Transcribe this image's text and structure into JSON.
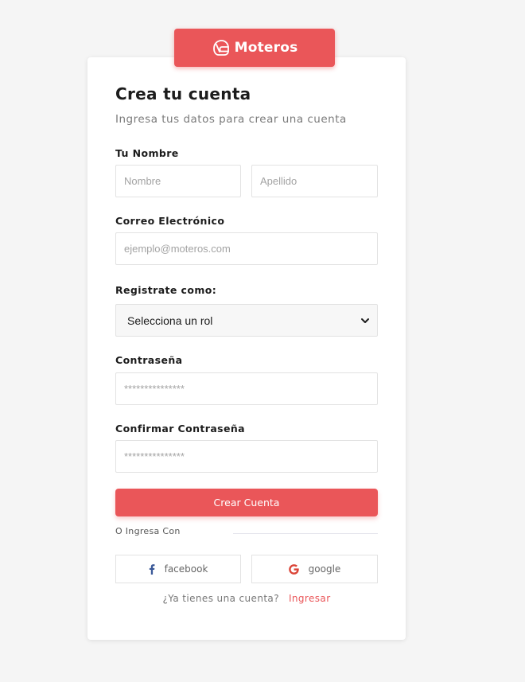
{
  "brand": {
    "name": "Moteros"
  },
  "form": {
    "title": "Crea tu cuenta",
    "subtitle": "Ingresa tus datos para crear una cuenta",
    "name_label": "Tu Nombre",
    "first_name_placeholder": "Nombre",
    "last_name_placeholder": "Apellido",
    "email_label": "Correo Electrónico",
    "email_placeholder": "ejemplo@moteros.com",
    "role_label": "Registrate como:",
    "role_selected": "Selecciona un rol",
    "password_label": "Contraseña",
    "password_placeholder": "***************",
    "confirm_label": "Confirmar Contraseña",
    "confirm_placeholder": "***************",
    "submit_label": "Crear Cuenta",
    "divider_text": "O Ingresa Con",
    "facebook_label": "facebook",
    "google_label": "google",
    "footer_text": "¿Ya tienes una cuenta?",
    "footer_link": "Ingresar"
  },
  "icons": {
    "brand": "helmet-icon",
    "select": "chevron-down-icon",
    "facebook": "facebook-icon",
    "google": "google-icon"
  },
  "colors": {
    "accent": "#ea5659",
    "background": "#f5f5f5",
    "card": "#ffffff",
    "facebook": "#3b5998",
    "google": "#db4437"
  }
}
